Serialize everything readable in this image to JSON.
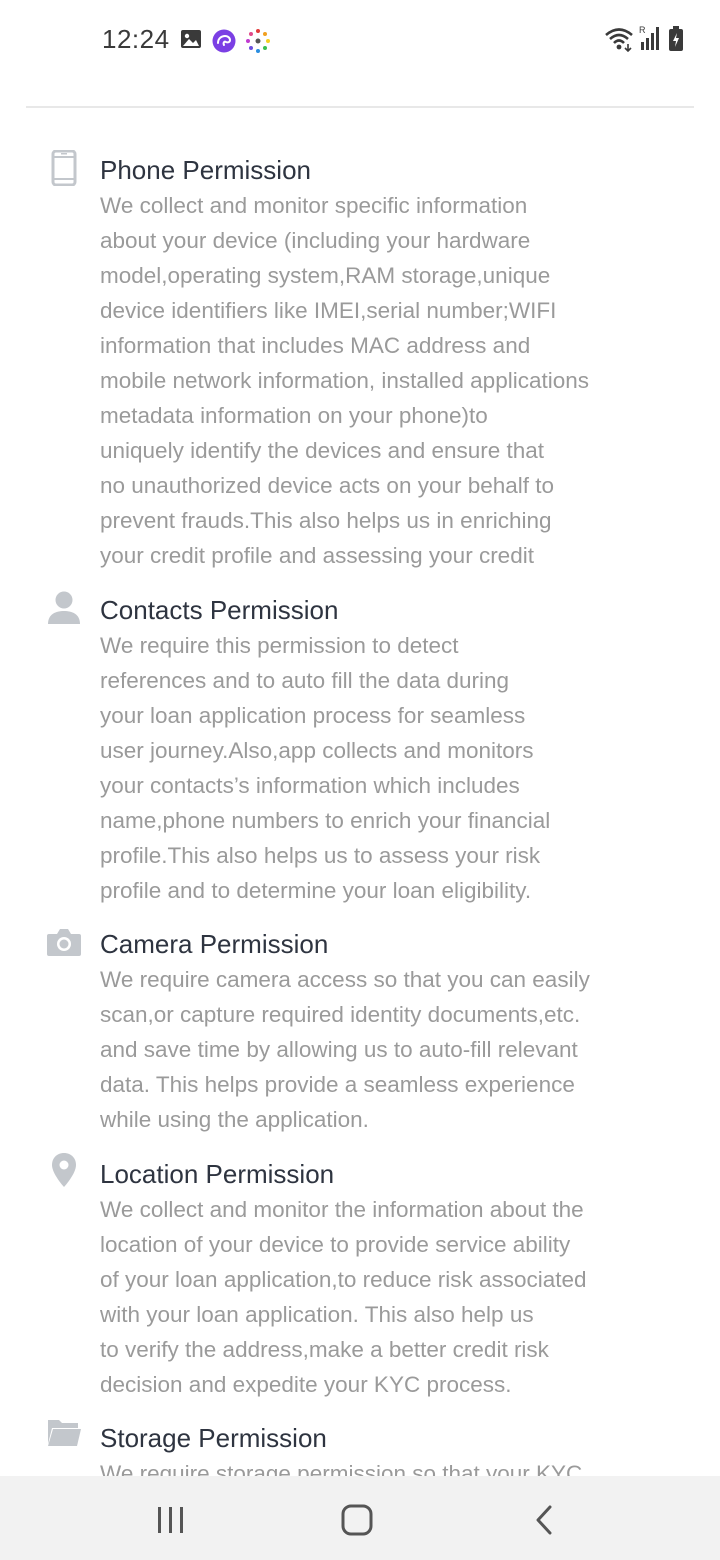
{
  "status_bar": {
    "time": "12:24",
    "notification_icons": [
      "image-icon",
      "messenger-icon",
      "sparkle-app-icon"
    ],
    "system_icons": [
      "wifi-icon",
      "signal-icon",
      "battery-charging-icon"
    ]
  },
  "permissions": [
    {
      "icon": "phone-icon",
      "title": "Phone Permission",
      "lines": [
        "We collect and monitor specific information",
        "about your device (including your hardware",
        "model,operating system,RAM storage,unique",
        "device identifiers like IMEI,serial number;WIFI",
        "information that includes MAC address and",
        "mobile network information, installed applications",
        "metadata information on your phone)to",
        "uniquely identify the devices and ensure that",
        "no unauthorized device acts on your behalf to",
        "prevent frauds.This also helps us in enriching",
        "your credit profile and assessing your credit"
      ]
    },
    {
      "icon": "contact-person-icon",
      "title": "Contacts Permission",
      "lines": [
        "We require this permission to detect",
        "references and to auto fill the data during",
        "your loan application process for seamless",
        "user journey.Also,app collects and monitors",
        "your contacts’s information which includes",
        "name,phone numbers to enrich your financial",
        "profile.This also helps us to assess your risk",
        "profile and to determine your loan eligibility."
      ]
    },
    {
      "icon": "camera-icon",
      "title": "Camera Permission",
      "lines": [
        "We require camera access so that you can easily",
        "scan,or capture required identity documents,etc.",
        "and save time by allowing us to auto-fill relevant",
        "data. This helps provide a seamless experience",
        "while using the application."
      ]
    },
    {
      "icon": "location-pin-icon",
      "title": "Location Permission",
      "lines": [
        "We collect and monitor the information about the",
        "location of your device to provide service ability",
        "of your loan application,to reduce risk associated",
        "with your loan application. This also help us",
        "to verify the address,make a better credit risk",
        "decision and expedite your KYC process."
      ]
    },
    {
      "icon": "folder-icon",
      "title": "Storage Permission",
      "lines": [
        "We require storage permission so that your KYC"
      ]
    }
  ],
  "nav_bar": {
    "buttons": [
      "recent-apps-icon",
      "home-icon",
      "back-icon"
    ]
  },
  "colors": {
    "title": "#2e3440",
    "description": "#9a9a9a",
    "icon": "#c3c7cc",
    "nav_background": "#f2f2f2"
  }
}
